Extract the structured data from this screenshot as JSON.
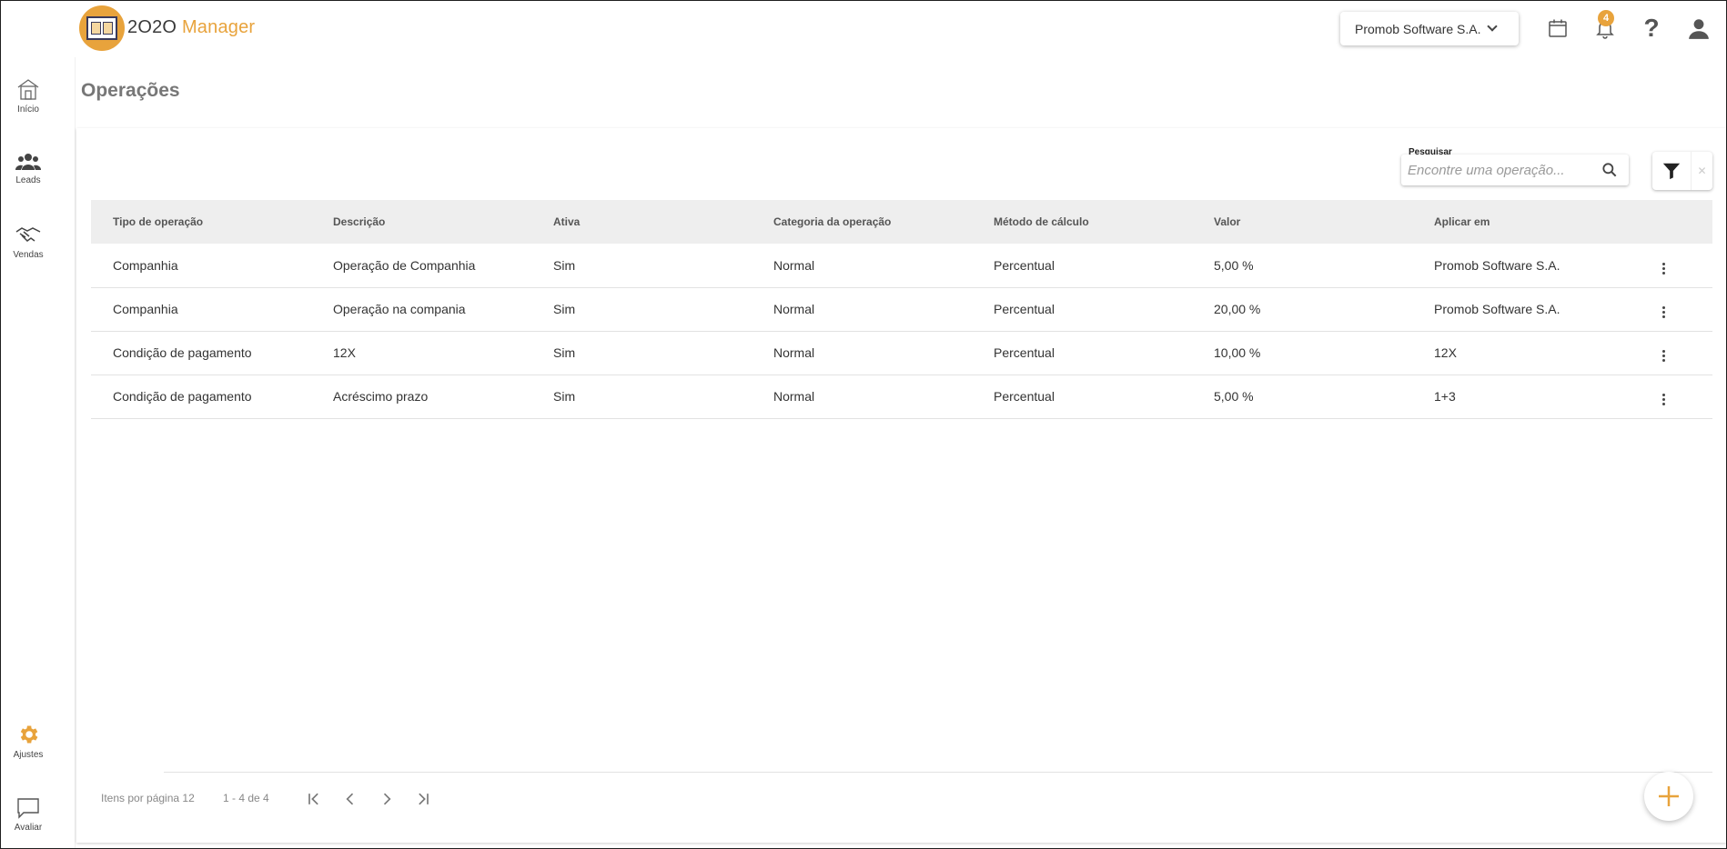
{
  "app": {
    "logo_text_main": "2O2O",
    "logo_text_accent": "Manager"
  },
  "header": {
    "company": "Promob Software S.A.",
    "notifications_count": "4",
    "help_label": "?"
  },
  "sidebar": {
    "items": [
      {
        "label": "Início",
        "icon": "home-icon"
      },
      {
        "label": "Leads",
        "icon": "people-icon"
      },
      {
        "label": "Vendas",
        "icon": "handshake-icon"
      },
      {
        "label": "Ajustes",
        "icon": "gear-icon"
      },
      {
        "label": "Avaliar",
        "icon": "chat-icon"
      }
    ]
  },
  "page": {
    "title": "Operações"
  },
  "search": {
    "label": "Pesquisar",
    "placeholder": "Encontre uma operação..."
  },
  "table": {
    "headers": [
      "Tipo de operação",
      "Descrição",
      "Ativa",
      "Categoria da operação",
      "Método de cálculo",
      "Valor",
      "Aplicar em"
    ],
    "rows": [
      [
        "Companhia",
        "Operação de Companhia",
        "Sim",
        "Normal",
        "Percentual",
        "5,00 %",
        "Promob Software S.A."
      ],
      [
        "Companhia",
        "Operação na compania",
        "Sim",
        "Normal",
        "Percentual",
        "20,00 %",
        "Promob Software S.A."
      ],
      [
        "Condição de pagamento",
        "12X",
        "Sim",
        "Normal",
        "Percentual",
        "10,00 %",
        "12X"
      ],
      [
        "Condição de pagamento",
        "Acréscimo prazo",
        "Sim",
        "Normal",
        "Percentual",
        "5,00 %",
        "1+3"
      ]
    ]
  },
  "pagination": {
    "items_per_page": "Itens por página 12",
    "range": "1 - 4 de 4"
  },
  "colors": {
    "accent": "#e8a33c",
    "header_row_bg": "#eeeeee",
    "title_gray": "#777777"
  }
}
